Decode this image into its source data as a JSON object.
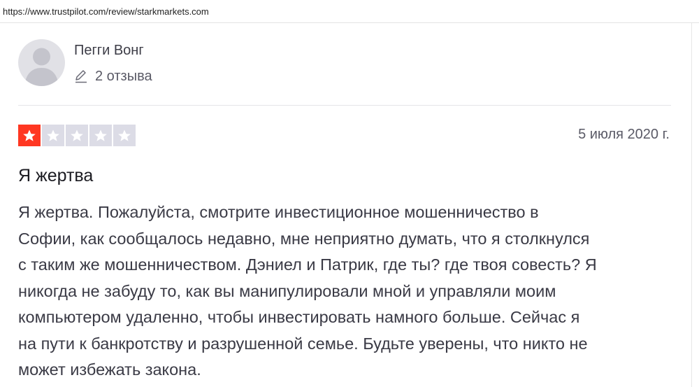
{
  "browser": {
    "url": "https://www.trustpilot.com/review/starkmarkets.com"
  },
  "reviewer": {
    "name": "Пегги Вонг",
    "review_count": "2 отзыва",
    "avatar_icon": "default-user-avatar",
    "pencil_icon": "pencil-icon"
  },
  "review": {
    "rating": 1,
    "max_rating": 5,
    "date": "5 июля 2020 г.",
    "title": "Я жертва",
    "body_lines": [
      "Я жертва. Пожалуйста, смотрите инвестиционное мошенничество в",
      "Софии, как сообщалось недавно, мне неприятно думать, что я столкнулся",
      "с таким же мошенничеством. Дэниел и Патрик, где ты? где твоя совесть? Я",
      "никогда не забуду то, как вы манипулировали мной и управляли моим",
      "компьютером удаленно, чтобы инвестировать намного больше. Сейчас я",
      "на пути к банкротству и разрушенной семье. Будьте уверены, что никто не",
      "может избежать закона."
    ]
  },
  "colors": {
    "star_filled": "#ff3722",
    "star_empty": "#dcdce6",
    "text_primary": "#1b1b21",
    "text_secondary": "#5a5a66",
    "avatar_bg": "#e1e1e6"
  }
}
